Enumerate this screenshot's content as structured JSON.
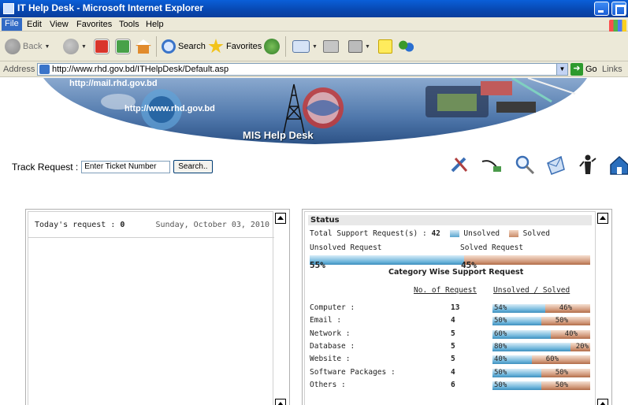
{
  "window": {
    "title": "IT Help Desk - Microsoft Internet Explorer"
  },
  "menu": [
    "File",
    "Edit",
    "View",
    "Favorites",
    "Tools",
    "Help"
  ],
  "toolbar": {
    "back": "Back",
    "search": "Search",
    "favorites": "Favorites"
  },
  "address": {
    "label": "Address",
    "url": "http://www.rhd.gov.bd/ITHelpDesk/Default.asp",
    "go": "Go",
    "links": "Links"
  },
  "banner": {
    "mail_url": "http://mail.rhd.gov.bd",
    "site_url": "http://www.rhd.gov.bd",
    "title": "MIS Help Desk"
  },
  "track": {
    "label": "Track Request :",
    "placeholder": "Enter Ticket Number",
    "button": "Search.."
  },
  "today": {
    "label": "Today's request :",
    "count": "0",
    "date": "Sunday, October 03, 2010"
  },
  "status": {
    "heading": "Status",
    "total_label": "Total Support Request(s) :",
    "total": "42",
    "legend_unsolved": "Unsolved",
    "legend_solved": "Solved",
    "unsolved_label": "Unsolved Request",
    "solved_label": "Solved Request",
    "unsolved_pct": 55,
    "solved_pct": 45,
    "unsolved_pct_text": "55%",
    "solved_pct_text": "45%",
    "category_title": "Category Wise Support Request",
    "col_requests": "No. of Request",
    "col_ratio": "Unsolved / Solved",
    "categories": [
      {
        "name": "Computer :",
        "count": "13",
        "unsolved": 54,
        "solved": 46,
        "unsolved_text": "54%",
        "solved_text": "46%"
      },
      {
        "name": "Email :",
        "count": "4",
        "unsolved": 50,
        "solved": 50,
        "unsolved_text": "50%",
        "solved_text": "50%"
      },
      {
        "name": "Network :",
        "count": "5",
        "unsolved": 60,
        "solved": 40,
        "unsolved_text": "60%",
        "solved_text": "40%"
      },
      {
        "name": "Database :",
        "count": "5",
        "unsolved": 80,
        "solved": 20,
        "unsolved_text": "80%",
        "solved_text": "20%"
      },
      {
        "name": "Website :",
        "count": "5",
        "unsolved": 40,
        "solved": 60,
        "unsolved_text": "40%",
        "solved_text": "60%"
      },
      {
        "name": "Software Packages :",
        "count": "4",
        "unsolved": 50,
        "solved": 50,
        "unsolved_text": "50%",
        "solved_text": "50%"
      },
      {
        "name": "Others :",
        "count": "6",
        "unsolved": 50,
        "solved": 50,
        "unsolved_text": "50%",
        "solved_text": "50%"
      }
    ]
  },
  "colors": {
    "unsolved": "#6ab3da",
    "solved": "#cf9576",
    "xp_blue": "#0a5fd8"
  },
  "icons": [
    "tools-icon",
    "network-cable-icon",
    "magnifier-icon",
    "mail-send-icon",
    "help-person-icon",
    "home-icon"
  ]
}
